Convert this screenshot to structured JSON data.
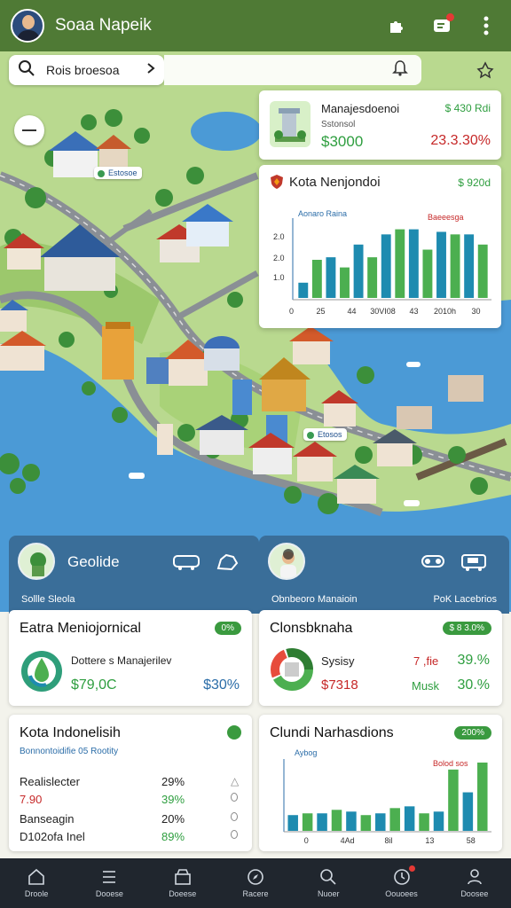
{
  "header": {
    "title": "Soaa Napeik",
    "icons": [
      "puzzle-icon",
      "chat-icon",
      "more-icon"
    ]
  },
  "search": {
    "placeholder": "Rois broesoa"
  },
  "map": {
    "labels": [
      "Estosoe",
      "Etosos"
    ]
  },
  "info_card": {
    "title": "Manajesdoenoi",
    "subtitle": "Sstonsol",
    "value": "$3000",
    "top_right": "$ 430 Rdi",
    "change": "23.3.30%"
  },
  "chart_card": {
    "title": "Kota Nenjondoi",
    "value": "$ 920d",
    "chart_data": {
      "type": "bar",
      "title": "Kota Nenjondoi",
      "legend": [
        "Aonaro Raina",
        "Baeeesga"
      ],
      "categories": [
        "25",
        "44",
        "30VI08",
        "43",
        "2010h",
        "30"
      ],
      "yticks": [
        "2.0",
        "2.0",
        "1.0",
        "0"
      ],
      "xtick_first": "0",
      "ylim": [
        0,
        3
      ],
      "series": [
        {
          "color": "#1e8bb0",
          "values": [
            0.6,
            1.6,
            2.1,
            2.5,
            2.7,
            2.6,
            2.5
          ]
        },
        {
          "color": "#4caf50",
          "values": [
            1.5,
            1.2,
            1.6,
            2.7,
            1.9,
            2.5,
            2.1
          ]
        }
      ]
    }
  },
  "panel_left": {
    "title": "Geolide",
    "subtitle": "Sollle Sleola"
  },
  "panel_right": {
    "subtitle": "Obnbeoro Manaioin",
    "subtitle_right": "PoK Lacebrios"
  },
  "card_a": {
    "title": "Eatra Meniojornical",
    "pill": "0%",
    "label": "Dottere s Manajerilev",
    "value": "$79,0C",
    "pct": "$30%"
  },
  "card_b": {
    "title": "Clonsbknaha",
    "pill": "$ 8 3.0%",
    "label1": "Sysisy",
    "val1a": "7 ,fie",
    "val1b": "39.%",
    "label2": "$7318",
    "val2a": "Musk",
    "val2b": "30.%"
  },
  "card_c": {
    "title": "Kota Indonelisih",
    "caption": "Bonnontoidifie 05 Rootity",
    "rows": [
      {
        "label": "Realislecter",
        "value": "29%"
      },
      {
        "label": "7.90",
        "value": "39%"
      },
      {
        "label": "Banseagin",
        "value": "20%"
      },
      {
        "label": "D102ofa Inel",
        "value": "89%"
      }
    ]
  },
  "card_d": {
    "title": "Clundi Narhasdions",
    "pill": "200%",
    "legend": "Aybog",
    "legend_right": "Bolod sos",
    "chart_data": {
      "type": "bar",
      "title": "Clundi Narhasdions",
      "categories": [
        "0",
        "4Ad",
        "8il",
        "13",
        "58"
      ],
      "series": [
        {
          "color": "#1e8bb0",
          "values": [
            0.9,
            1.0,
            1.1,
            1.0,
            1.4,
            1.1,
            2.2
          ]
        },
        {
          "color": "#4caf50",
          "values": [
            1.0,
            1.2,
            0.9,
            1.3,
            1.0,
            3.5,
            3.9
          ]
        }
      ],
      "ylim": [
        0,
        4
      ]
    }
  },
  "nav": {
    "items": [
      "Droole",
      "Dooese",
      "Doeese",
      "Racere",
      "Nuoer",
      "Oouoees",
      "Doosee"
    ]
  }
}
